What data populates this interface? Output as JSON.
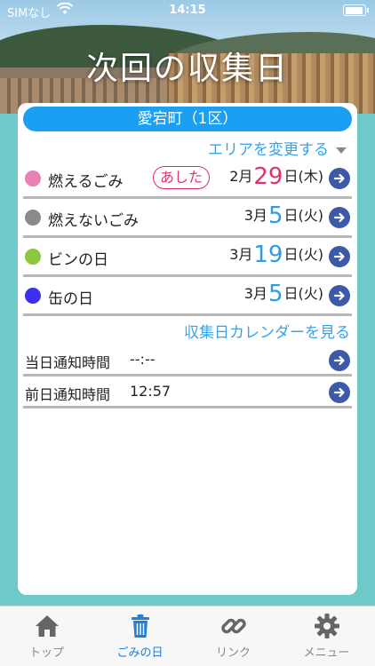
{
  "status_bar": {
    "carrier": "SIMなし",
    "time": "14:15",
    "wifi_icon": "wifi-icon",
    "battery_icon": "battery-icon"
  },
  "header": {
    "title": "次回の収集日"
  },
  "area": {
    "name": "愛宕町（1区）",
    "change_label": "エリアを変更する"
  },
  "colors": {
    "accent": "#1a9ff2",
    "background": "#6ec9c9",
    "highlight": "#e0316e",
    "arrow": "#3c5aa8"
  },
  "schedule": [
    {
      "name": "燃えるごみ",
      "color": "#e882b4",
      "badge": "あした",
      "month": "2",
      "month_unit": "月",
      "day": "29",
      "day_unit": "日",
      "weekday": "(木)",
      "day_color": "#e0316e"
    },
    {
      "name": "燃えないごみ",
      "color": "#8a8a8a",
      "badge": "",
      "month": "3",
      "month_unit": "月",
      "day": "5",
      "day_unit": "日",
      "weekday": "(火)",
      "day_color": "#2e9be6"
    },
    {
      "name": "ビンの日",
      "color": "#8dc63f",
      "badge": "",
      "month": "3",
      "month_unit": "月",
      "day": "19",
      "day_unit": "日",
      "weekday": "(火)",
      "day_color": "#2e9be6"
    },
    {
      "name": "缶の日",
      "color": "#3b30f0",
      "badge": "",
      "month": "3",
      "month_unit": "月",
      "day": "5",
      "day_unit": "日",
      "weekday": "(火)",
      "day_color": "#2e9be6"
    }
  ],
  "calendar_link": "収集日カレンダーを見る",
  "notifications": [
    {
      "label": "当日通知時間",
      "value": "--:--"
    },
    {
      "label": "前日通知時間",
      "value": "12:57"
    }
  ],
  "tabs": [
    {
      "label": "トップ",
      "icon": "home-icon"
    },
    {
      "label": "ごみの日",
      "icon": "trash-icon",
      "active": true
    },
    {
      "label": "リンク",
      "icon": "link-icon"
    },
    {
      "label": "メニュー",
      "icon": "gear-icon"
    }
  ]
}
